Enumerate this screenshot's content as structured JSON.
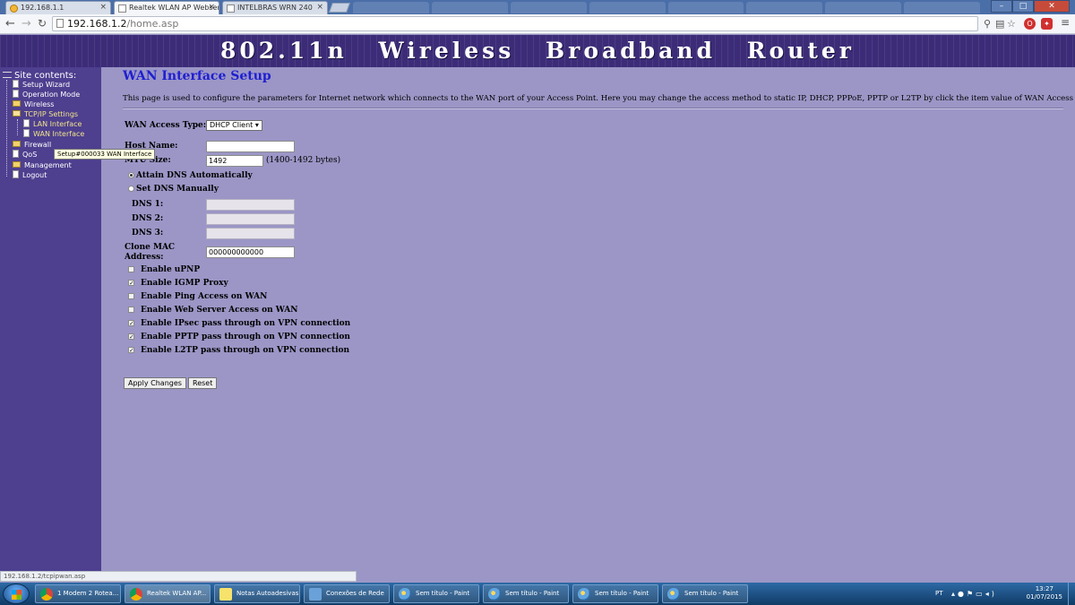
{
  "browser": {
    "tabs": [
      {
        "title": "192.168.1.1",
        "icon": "warning-icon",
        "active": false
      },
      {
        "title": "Realtek WLAN AP Webser",
        "icon": "page-icon",
        "active": true
      },
      {
        "title": "INTELBRAS WRN 240",
        "icon": "page-icon",
        "active": false
      }
    ],
    "tab_close": "×",
    "url_host": "192.168.1.2",
    "url_path": "/home.asp",
    "status_url": "192.168.1.2/tcpipwan.asp",
    "window_controls": {
      "minimize": "–",
      "maximize": "□",
      "close": "✕"
    }
  },
  "banner": {
    "title": "802.11n Wireless Broadband Router"
  },
  "sidebar": {
    "heading": "Site contents:",
    "items": [
      {
        "label": "Setup Wizard",
        "icon": "page-icon"
      },
      {
        "label": "Operation Mode",
        "icon": "page-icon"
      },
      {
        "label": "Wireless",
        "icon": "folder-icon"
      },
      {
        "label": "TCP/IP Settings",
        "icon": "folder-open-icon"
      },
      {
        "label": "LAN Interface",
        "icon": "page-icon"
      },
      {
        "label": "WAN Interface",
        "icon": "page-icon"
      },
      {
        "label": "Firewall",
        "icon": "folder-icon"
      },
      {
        "label": "QoS",
        "icon": "page-icon"
      },
      {
        "label": "Management",
        "icon": "folder-icon"
      },
      {
        "label": "Logout",
        "icon": "page-icon"
      }
    ],
    "tooltip": "Setup#000033 WAN Interface"
  },
  "main": {
    "title": "WAN Interface Setup",
    "description": "This page is used to configure the parameters for Internet network which connects to the WAN port of your Access Point. Here you may change the access method to static IP, DHCP, PPPoE, PPTP or L2TP by click the item value of WAN Access type.",
    "wan_access_type": {
      "label": "WAN Access Type:",
      "value": "DHCP Client ▾"
    },
    "host_name": {
      "label": "Host Name:",
      "value": ""
    },
    "mtu": {
      "label": "MTU Size:",
      "value": "1492",
      "hint": "(1400-1492 bytes)"
    },
    "dns_auto": {
      "label": "Attain DNS Automatically",
      "checked": true
    },
    "dns_manual": {
      "label": "Set DNS Manually",
      "checked": false
    },
    "dns1": {
      "label": "DNS 1:",
      "value": ""
    },
    "dns2": {
      "label": "DNS 2:",
      "value": ""
    },
    "dns3": {
      "label": "DNS 3:",
      "value": ""
    },
    "clone_mac": {
      "label_line1": "Clone MAC",
      "label_line2": "Address:",
      "value": "000000000000"
    },
    "options": [
      {
        "label": "Enable uPNP",
        "checked": false
      },
      {
        "label": "Enable IGMP Proxy",
        "checked": true
      },
      {
        "label": "Enable Ping Access on WAN",
        "checked": false
      },
      {
        "label": "Enable Web Server Access on WAN",
        "checked": false
      },
      {
        "label": "Enable IPsec pass through on VPN connection",
        "checked": true
      },
      {
        "label": "Enable PPTP pass through on VPN connection",
        "checked": true
      },
      {
        "label": "Enable L2TP pass through on VPN connection",
        "checked": true
      }
    ],
    "apply_label": "Apply Changes",
    "reset_label": "Reset"
  },
  "taskbar": {
    "tasks": [
      {
        "label": "1 Modem 2 Rotea...",
        "icon": "chrome-icon"
      },
      {
        "label": "Realtek WLAN AP...",
        "icon": "chrome-icon"
      },
      {
        "label": "Notas Autoadesivas",
        "icon": "sticky-notes-icon"
      },
      {
        "label": "Conexões de Rede",
        "icon": "network-icon"
      },
      {
        "label": "Sem título - Paint",
        "icon": "paint-icon"
      },
      {
        "label": "Sem título - Paint",
        "icon": "paint-icon"
      },
      {
        "label": "Sem título - Paint",
        "icon": "paint-icon"
      },
      {
        "label": "Sem título - Paint",
        "icon": "paint-icon"
      }
    ],
    "language": "PT",
    "time": "13:27",
    "date": "01/07/2015"
  },
  "colors": {
    "banner": "#3c2c78",
    "sidebar": "#4e3f8f",
    "content_bg": "#9b96c6",
    "title_blue": "#1f1fd0",
    "active_nav": "#f0e38a"
  }
}
